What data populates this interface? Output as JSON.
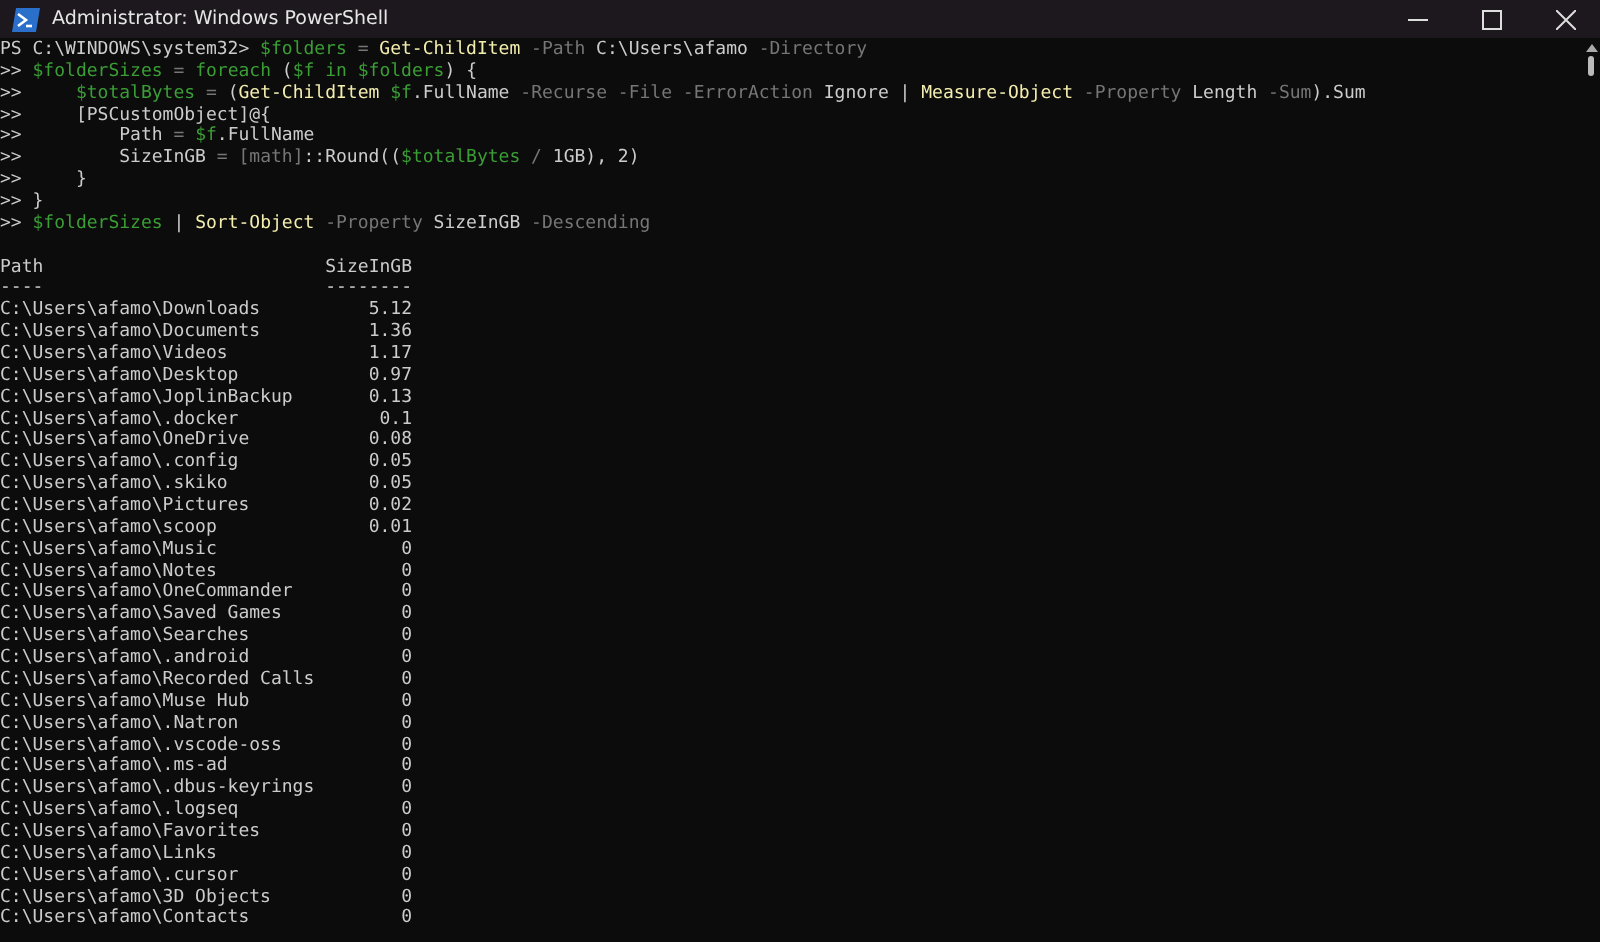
{
  "window": {
    "title": "Administrator: Windows PowerShell"
  },
  "console": {
    "lines": [
      {
        "tokens": [
          {
            "kind": "prompt",
            "text": "PS C:\\WINDOWS\\system32> "
          },
          {
            "kind": "variable",
            "text": "$folders"
          },
          {
            "kind": "operator",
            "text": " = "
          },
          {
            "kind": "command",
            "text": "Get-ChildItem"
          },
          {
            "kind": "parameter",
            "text": " -Path"
          },
          {
            "kind": "plain",
            "text": " C:\\Users\\afamo"
          },
          {
            "kind": "parameter",
            "text": " -Directory"
          }
        ]
      },
      {
        "tokens": [
          {
            "kind": "prompt",
            "text": ">> "
          },
          {
            "kind": "variable",
            "text": "$folderSizes"
          },
          {
            "kind": "operator",
            "text": " = "
          },
          {
            "kind": "variable",
            "text": "foreach"
          },
          {
            "kind": "plain",
            "text": " ("
          },
          {
            "kind": "variable",
            "text": "$f"
          },
          {
            "kind": "variable",
            "text": " in "
          },
          {
            "kind": "variable",
            "text": "$folders"
          },
          {
            "kind": "plain",
            "text": ") {"
          }
        ]
      },
      {
        "tokens": [
          {
            "kind": "prompt",
            "text": ">>     "
          },
          {
            "kind": "variable",
            "text": "$totalBytes"
          },
          {
            "kind": "operator",
            "text": " = "
          },
          {
            "kind": "plain",
            "text": "("
          },
          {
            "kind": "command",
            "text": "Get-ChildItem"
          },
          {
            "kind": "variable",
            "text": " $f"
          },
          {
            "kind": "plain",
            "text": ".FullName"
          },
          {
            "kind": "parameter",
            "text": " -Recurse -File -ErrorAction"
          },
          {
            "kind": "plain",
            "text": " Ignore | "
          },
          {
            "kind": "command",
            "text": "Measure-Object"
          },
          {
            "kind": "parameter",
            "text": " -Property"
          },
          {
            "kind": "plain",
            "text": " Length"
          },
          {
            "kind": "parameter",
            "text": " -Sum"
          },
          {
            "kind": "plain",
            "text": ").Sum"
          }
        ]
      },
      {
        "tokens": [
          {
            "kind": "prompt",
            "text": ">>     "
          },
          {
            "kind": "plain",
            "text": "[PSCustomObject]@{"
          }
        ]
      },
      {
        "tokens": [
          {
            "kind": "prompt",
            "text": ">>         "
          },
          {
            "kind": "plain",
            "text": "Path"
          },
          {
            "kind": "operator",
            "text": " = "
          },
          {
            "kind": "variable",
            "text": "$f"
          },
          {
            "kind": "plain",
            "text": ".FullName"
          }
        ]
      },
      {
        "tokens": [
          {
            "kind": "prompt",
            "text": ">>         "
          },
          {
            "kind": "plain",
            "text": "SizeInGB"
          },
          {
            "kind": "operator",
            "text": " = "
          },
          {
            "kind": "operator",
            "text": "[math]"
          },
          {
            "kind": "plain",
            "text": "::Round(("
          },
          {
            "kind": "variable",
            "text": "$totalBytes"
          },
          {
            "kind": "operator",
            "text": " / "
          },
          {
            "kind": "plain",
            "text": "1GB), 2)"
          }
        ]
      },
      {
        "tokens": [
          {
            "kind": "prompt",
            "text": ">>     "
          },
          {
            "kind": "plain",
            "text": "}"
          }
        ]
      },
      {
        "tokens": [
          {
            "kind": "prompt",
            "text": ">> "
          },
          {
            "kind": "plain",
            "text": "}"
          }
        ]
      },
      {
        "tokens": [
          {
            "kind": "prompt",
            "text": ">> "
          },
          {
            "kind": "variable",
            "text": "$folderSizes"
          },
          {
            "kind": "plain",
            "text": " | "
          },
          {
            "kind": "command",
            "text": "Sort-Object"
          },
          {
            "kind": "parameter",
            "text": " -Property"
          },
          {
            "kind": "plain",
            "text": " SizeInGB"
          },
          {
            "kind": "parameter",
            "text": " -Descending"
          }
        ]
      }
    ]
  },
  "table": {
    "columns": [
      "Path",
      "SizeInGB"
    ],
    "rules": [
      "----",
      "--------"
    ],
    "rows": [
      [
        "C:\\Users\\afamo\\Downloads",
        "5.12"
      ],
      [
        "C:\\Users\\afamo\\Documents",
        "1.36"
      ],
      [
        "C:\\Users\\afamo\\Videos",
        "1.17"
      ],
      [
        "C:\\Users\\afamo\\Desktop",
        "0.97"
      ],
      [
        "C:\\Users\\afamo\\JoplinBackup",
        "0.13"
      ],
      [
        "C:\\Users\\afamo\\.docker",
        "0.1"
      ],
      [
        "C:\\Users\\afamo\\OneDrive",
        "0.08"
      ],
      [
        "C:\\Users\\afamo\\.config",
        "0.05"
      ],
      [
        "C:\\Users\\afamo\\.skiko",
        "0.05"
      ],
      [
        "C:\\Users\\afamo\\Pictures",
        "0.02"
      ],
      [
        "C:\\Users\\afamo\\scoop",
        "0.01"
      ],
      [
        "C:\\Users\\afamo\\Music",
        "0"
      ],
      [
        "C:\\Users\\afamo\\Notes",
        "0"
      ],
      [
        "C:\\Users\\afamo\\OneCommander",
        "0"
      ],
      [
        "C:\\Users\\afamo\\Saved Games",
        "0"
      ],
      [
        "C:\\Users\\afamo\\Searches",
        "0"
      ],
      [
        "C:\\Users\\afamo\\.android",
        "0"
      ],
      [
        "C:\\Users\\afamo\\Recorded Calls",
        "0"
      ],
      [
        "C:\\Users\\afamo\\Muse Hub",
        "0"
      ],
      [
        "C:\\Users\\afamo\\.Natron",
        "0"
      ],
      [
        "C:\\Users\\afamo\\.vscode-oss",
        "0"
      ],
      [
        "C:\\Users\\afamo\\.ms-ad",
        "0"
      ],
      [
        "C:\\Users\\afamo\\.dbus-keyrings",
        "0"
      ],
      [
        "C:\\Users\\afamo\\.logseq",
        "0"
      ],
      [
        "C:\\Users\\afamo\\Favorites",
        "0"
      ],
      [
        "C:\\Users\\afamo\\Links",
        "0"
      ],
      [
        "C:\\Users\\afamo\\.cursor",
        "0"
      ],
      [
        "C:\\Users\\afamo\\3D Objects",
        "0"
      ],
      [
        "C:\\Users\\afamo\\Contacts",
        "0"
      ]
    ]
  }
}
